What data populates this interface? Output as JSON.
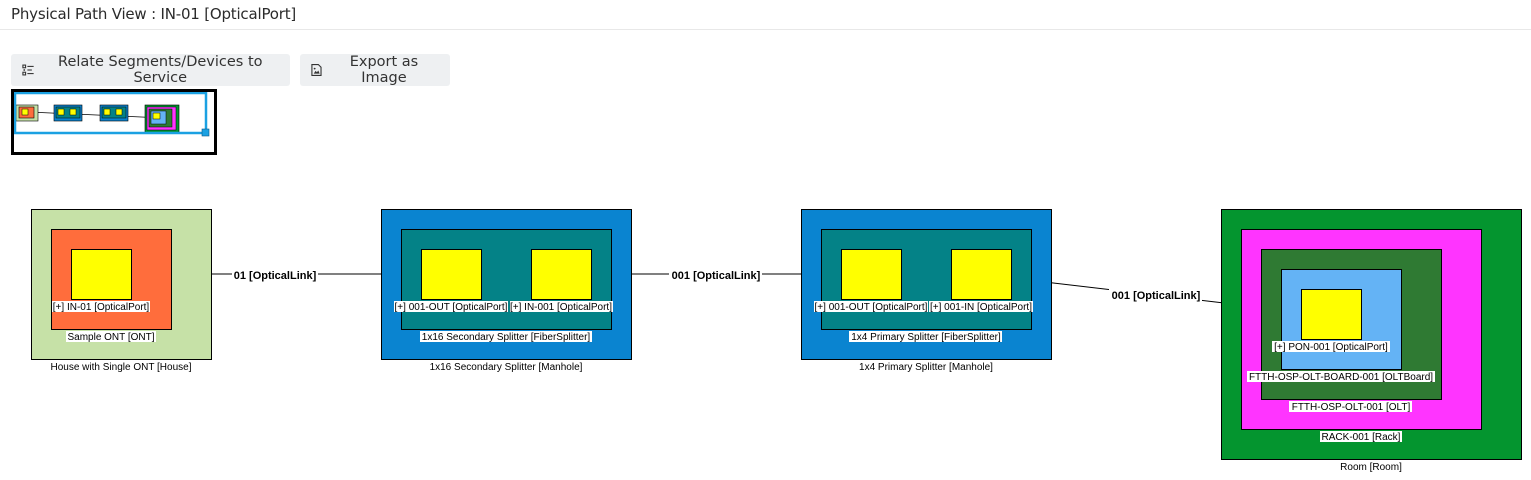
{
  "page": {
    "title": "Physical Path View : IN-01 [OpticalPort]"
  },
  "toolbar": {
    "relate_label": "Relate Segments/Devices to Service",
    "export_label": "Export as Image"
  },
  "diagram": {
    "house": {
      "label": "House with Single ONT [House]",
      "ont_label": "Sample ONT [ONT]",
      "port_label": "[+] IN-01 [OpticalPort]"
    },
    "manhole_secondary": {
      "label": "1x16 Secondary Splitter [Manhole]",
      "splitter_label": "1x16 Secondary Splitter [FiberSplitter]",
      "port_out_label": "[+] 001-OUT [OpticalPort]",
      "port_in_label": "[+] IN-001 [OpticalPort]"
    },
    "manhole_primary": {
      "label": "1x4 Primary Splitter [Manhole]",
      "splitter_label": "1x4 Primary Splitter [FiberSplitter]",
      "port_out_label": "[+] 001-OUT [OpticalPort]",
      "port_in_label": "[+] 001-IN [OpticalPort]"
    },
    "room": {
      "label": "Room [Room]",
      "rack_label": "RACK-001 [Rack]",
      "olt_label": "FTTH-OSP-OLT-001 [OLT]",
      "board_label": "FTTH-OSP-OLT-BOARD-001 [OLTBoard]",
      "port_label": "[+] PON-001 [OpticalPort]"
    },
    "links": [
      {
        "label": "01 [OpticalLink]"
      },
      {
        "label": "001 [OpticalLink]"
      },
      {
        "label": "001 [OpticalLink]"
      }
    ],
    "colors": {
      "house": "#c6e1a7",
      "ont": "#ff6d3c",
      "port": "#ffff00",
      "manhole": "#0a84d0",
      "splitter": "#048287",
      "room": "#04952f",
      "rack": "#ff34ff",
      "olt": "#2f7a33",
      "board": "#64b3f5"
    }
  }
}
